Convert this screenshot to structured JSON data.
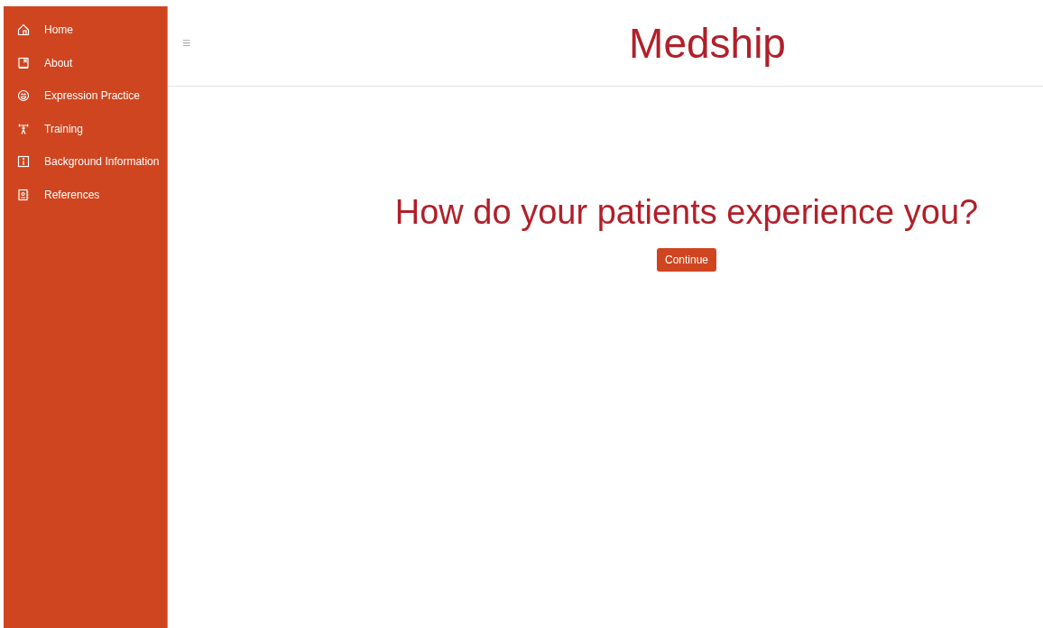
{
  "sidebar": {
    "items": [
      {
        "label": "Home"
      },
      {
        "label": "About"
      },
      {
        "label": "Expression Practice"
      },
      {
        "label": "Training"
      },
      {
        "label": "Background Information"
      },
      {
        "label": "References"
      }
    ]
  },
  "header": {
    "menu_icon": "≡",
    "title": "Medship"
  },
  "main": {
    "heading": "How do your patients experience you?",
    "button": "Continue"
  }
}
